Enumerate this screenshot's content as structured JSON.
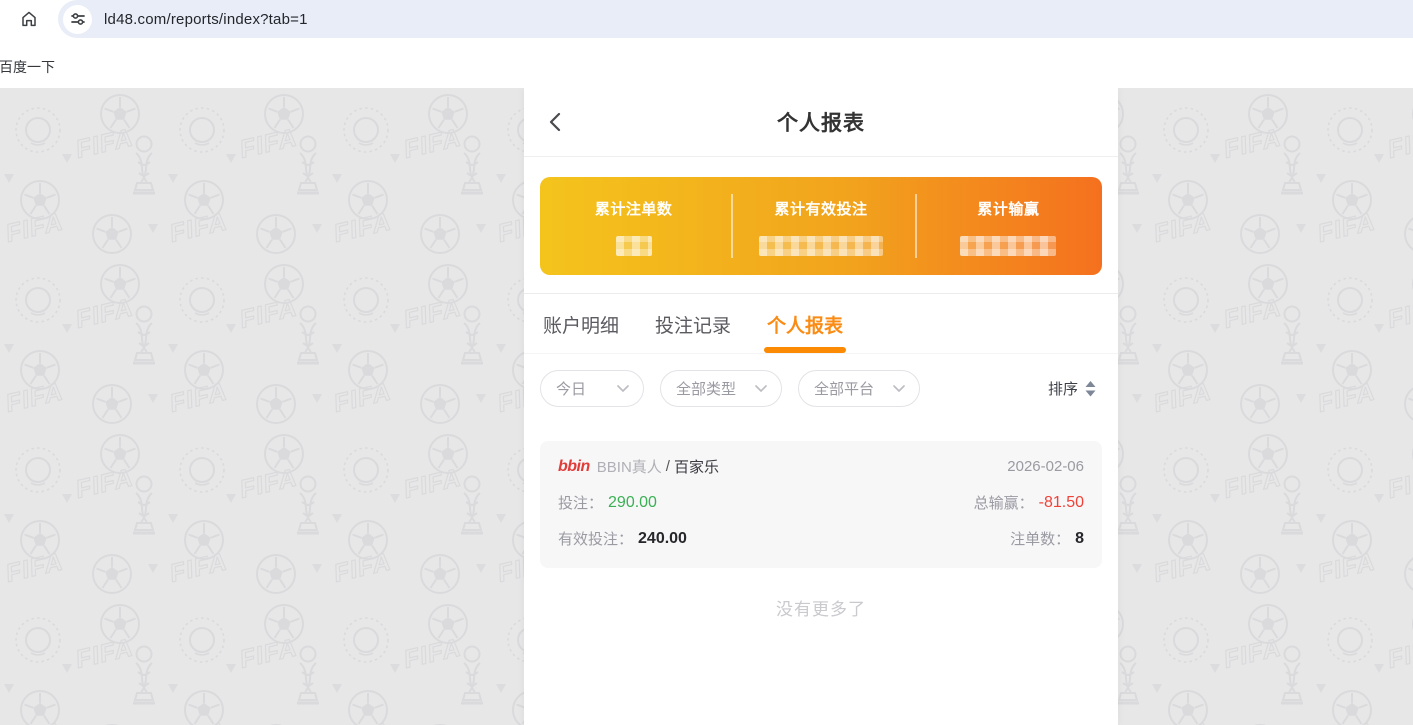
{
  "browser": {
    "url": "ld48.com/reports/index?tab=1",
    "bookmark_label": "百度一下"
  },
  "page": {
    "title": "个人报表",
    "summary": {
      "stats": [
        {
          "label": "累计注单数",
          "masked": true
        },
        {
          "label": "累计有效投注",
          "masked": true
        },
        {
          "label": "累计输赢",
          "masked": true
        }
      ]
    },
    "tabs": [
      {
        "label": "账户明细",
        "active": false
      },
      {
        "label": "投注记录",
        "active": false
      },
      {
        "label": "个人报表",
        "active": true
      }
    ],
    "filters": [
      {
        "label": "今日"
      },
      {
        "label": "全部类型"
      },
      {
        "label": "全部平台"
      }
    ],
    "sort_label": "排序",
    "records": [
      {
        "provider_logo": "bbin",
        "provider": "BBIN真人",
        "separator": "/",
        "game": "百家乐",
        "date": "2026-02-06",
        "bet_label": "投注：",
        "bet_value": "290.00",
        "total_label": "总输赢：",
        "total_value": "-81.50",
        "valid_label": "有效投注：",
        "valid_value": "240.00",
        "count_label": "注单数：",
        "count_value": "8"
      }
    ],
    "empty_text": "没有更多了"
  },
  "colors": {
    "accent_orange": "#fa8c16",
    "card_gradient_start": "#f4c41c",
    "card_gradient_end": "#f5701e",
    "positive_green": "#3bb054",
    "negative_red": "#f04238",
    "logo_red": "#e23c39"
  },
  "icons": [
    "home-icon",
    "site-controls-icon",
    "back-chevron-icon",
    "chevron-down-icon",
    "sort-arrows-icon",
    "fifa-pattern-background"
  ]
}
